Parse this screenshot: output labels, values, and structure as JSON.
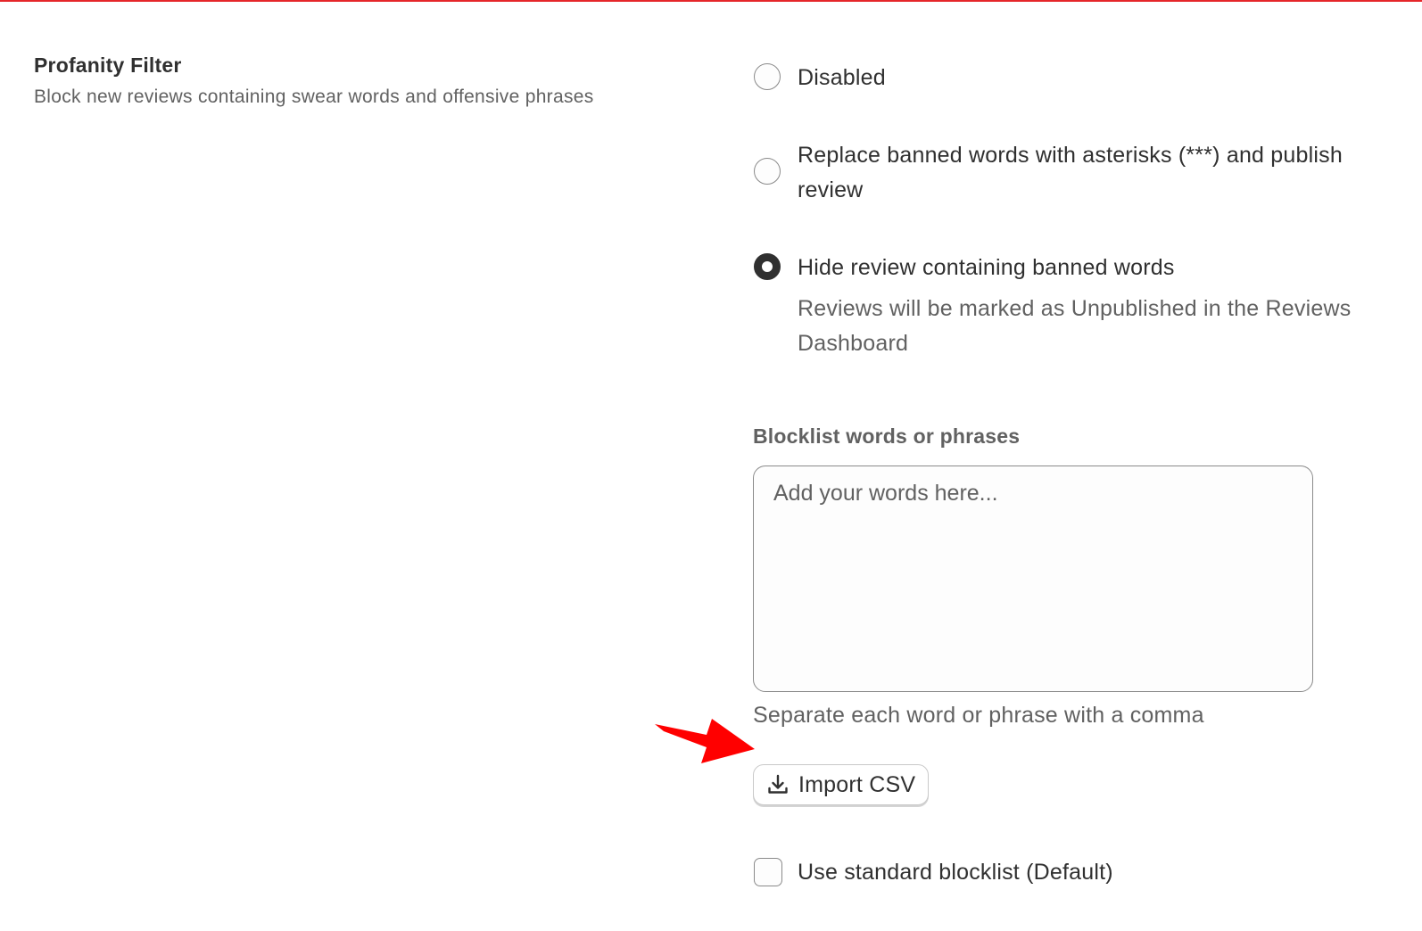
{
  "section": {
    "title": "Profanity Filter",
    "description": "Block new reviews containing swear words and offensive phrases"
  },
  "filter_options": [
    {
      "label": "Disabled",
      "selected": false
    },
    {
      "label": "Replace banned words with asterisks (***) and publish review",
      "selected": false
    },
    {
      "label": "Hide review containing banned words",
      "selected": true,
      "help": "Reviews will be marked as Unpublished in the Reviews Dashboard"
    }
  ],
  "blocklist": {
    "label": "Blocklist words or phrases",
    "placeholder": "Add your words here...",
    "value": "",
    "help": "Separate each word or phrase with a comma"
  },
  "import_button": {
    "label": "Import CSV",
    "icon": "download-icon"
  },
  "standard_blocklist": {
    "label": "Use standard blocklist (Default)",
    "checked": false
  },
  "colors": {
    "accent_line": "#e5262a",
    "annotation_arrow": "#ff0000",
    "text_primary": "#303030",
    "text_secondary": "#616161"
  }
}
